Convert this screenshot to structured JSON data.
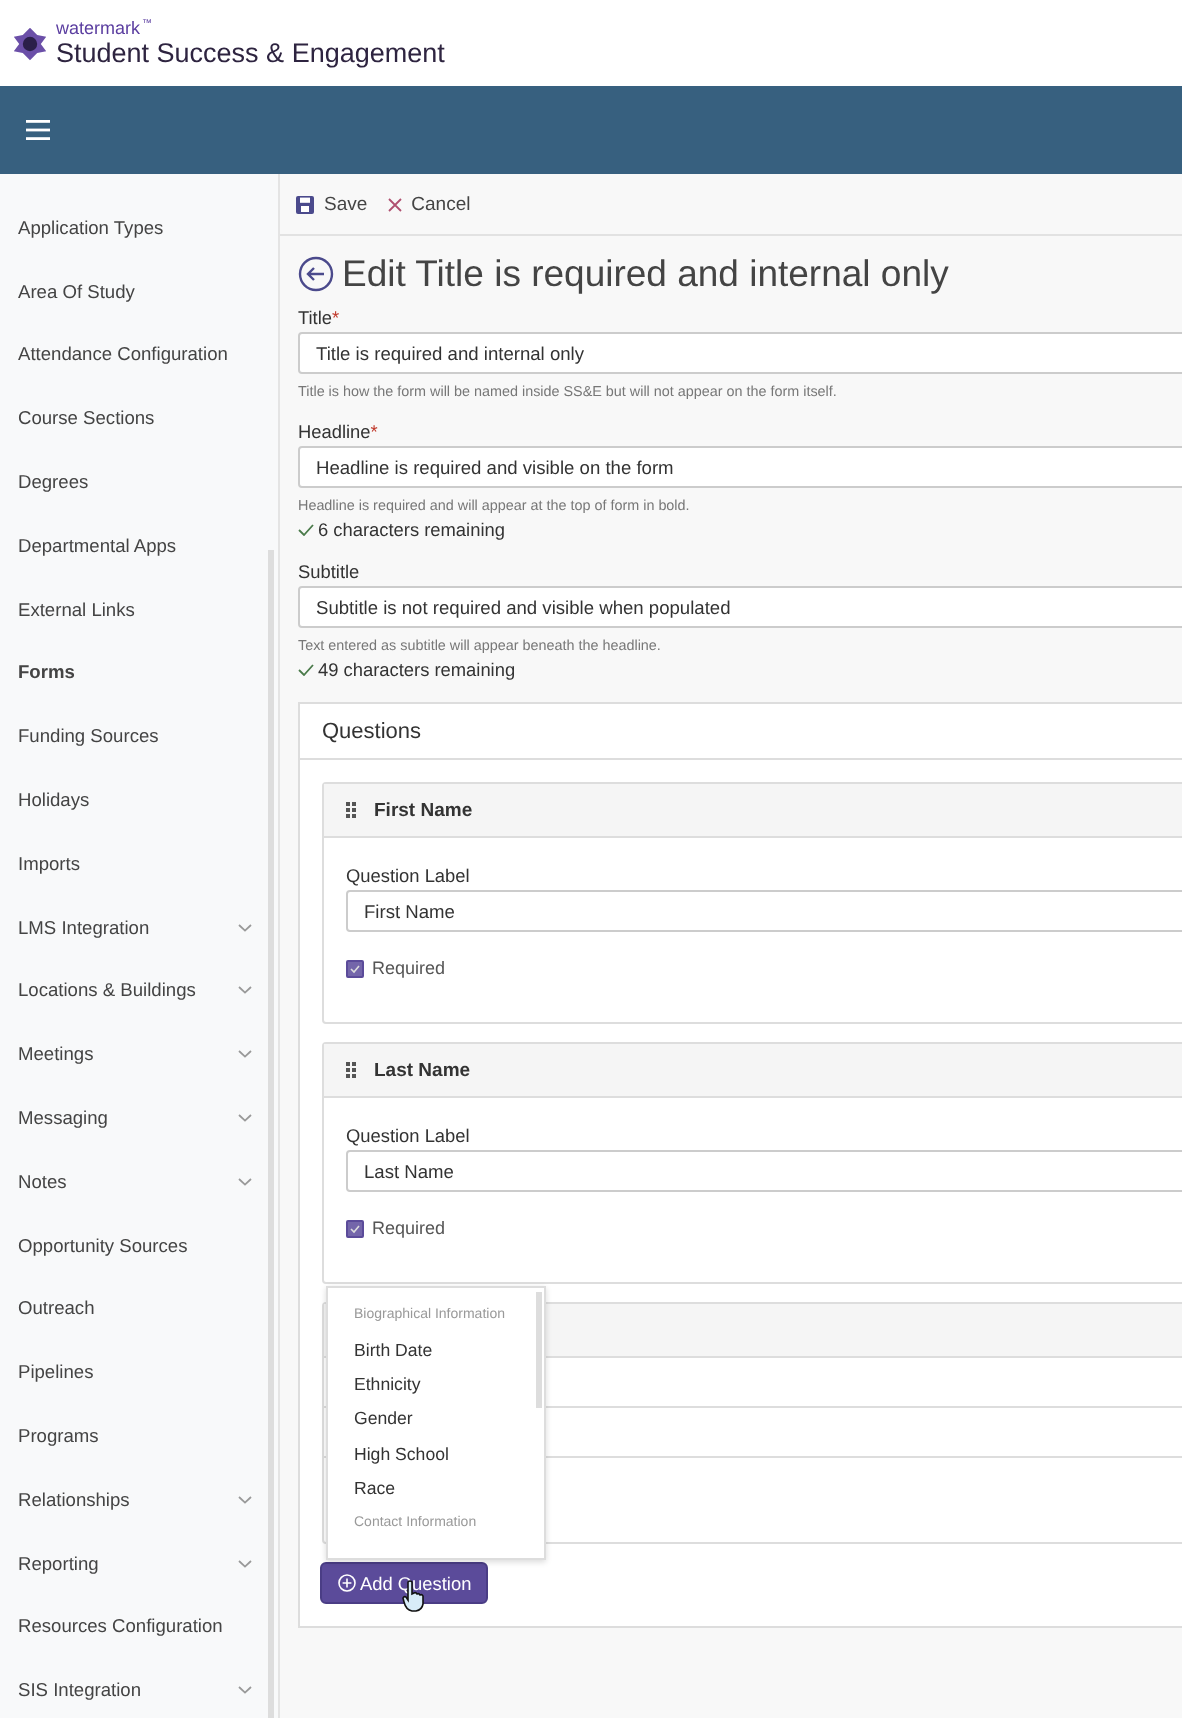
{
  "app": {
    "brand": "watermark",
    "trademark": "™",
    "product": "Student Success & Engagement"
  },
  "sidebar": {
    "items": [
      {
        "label": "Application Types",
        "selected": false,
        "expandable": false
      },
      {
        "label": "Area Of Study",
        "selected": false,
        "expandable": false
      },
      {
        "label": "Attendance Configuration",
        "selected": false,
        "expandable": false
      },
      {
        "label": "Course Sections",
        "selected": false,
        "expandable": false
      },
      {
        "label": "Degrees",
        "selected": false,
        "expandable": false
      },
      {
        "label": "Departmental Apps",
        "selected": false,
        "expandable": false
      },
      {
        "label": "External Links",
        "selected": false,
        "expandable": false
      },
      {
        "label": "Forms",
        "selected": true,
        "expandable": false
      },
      {
        "label": "Funding Sources",
        "selected": false,
        "expandable": false
      },
      {
        "label": "Holidays",
        "selected": false,
        "expandable": false
      },
      {
        "label": "Imports",
        "selected": false,
        "expandable": false
      },
      {
        "label": "LMS Integration",
        "selected": false,
        "expandable": true
      },
      {
        "label": "Locations & Buildings",
        "selected": false,
        "expandable": true
      },
      {
        "label": "Meetings",
        "selected": false,
        "expandable": true
      },
      {
        "label": "Messaging",
        "selected": false,
        "expandable": true
      },
      {
        "label": "Notes",
        "selected": false,
        "expandable": true
      },
      {
        "label": "Opportunity Sources",
        "selected": false,
        "expandable": false
      },
      {
        "label": "Outreach",
        "selected": false,
        "expandable": false
      },
      {
        "label": "Pipelines",
        "selected": false,
        "expandable": false
      },
      {
        "label": "Programs",
        "selected": false,
        "expandable": false
      },
      {
        "label": "Relationships",
        "selected": false,
        "expandable": true
      },
      {
        "label": "Reporting",
        "selected": false,
        "expandable": true
      },
      {
        "label": "Resources Configuration",
        "selected": false,
        "expandable": false
      },
      {
        "label": "SIS Integration",
        "selected": false,
        "expandable": true
      }
    ]
  },
  "toolbar": {
    "buttons": [
      {
        "label": "Save",
        "kind": "save"
      },
      {
        "label": "Cancel",
        "kind": "cancel"
      }
    ]
  },
  "page_title": "Edit Title is required and internal only",
  "fields": [
    {
      "label": "Title",
      "required_mark": "*",
      "value": "Title is required and internal only",
      "help": "Title is how the form will be named inside SS&E but will not appear on the form itself."
    },
    {
      "label": "Headline",
      "required_mark": "*",
      "value": "Headline is required and visible on the form",
      "help": "Headline is required and will appear at the top of form in bold.",
      "remaining": "6 characters remaining"
    },
    {
      "label": "Subtitle",
      "value": "Subtitle is not required and visible when populated",
      "help": "Text entered as subtitle will appear beneath the headline.",
      "remaining": "49 characters remaining"
    }
  ],
  "questions": {
    "title": "Questions",
    "items": [
      {
        "title": "First Name",
        "label": "Question Label",
        "value": "First Name",
        "checkbox_label": "Required",
        "checked": true
      },
      {
        "title": "Last Name",
        "label": "Question Label",
        "value": "Last Name",
        "checkbox_label": "Required",
        "checked": true
      }
    ],
    "dropdown": {
      "groups": [
        {
          "heading": "Biographical Information",
          "items": [
            "Birth Date",
            "Ethnicity",
            "Gender",
            "High School",
            "Race"
          ]
        },
        {
          "heading": "Contact Information"
        }
      ]
    },
    "add_button": "Add Question"
  }
}
